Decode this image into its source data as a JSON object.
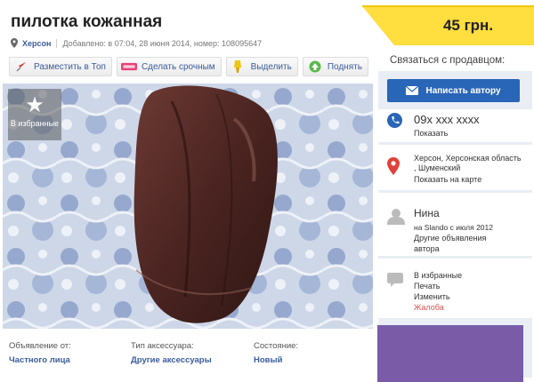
{
  "ad": {
    "title": "пилотка кожанная",
    "city": "Херсон",
    "added": "Добавлено: в 07:04, 28 июня 2014, номер: 108095647"
  },
  "actions": [
    {
      "label": "Разместить в Топ",
      "icon": "rocket-icon"
    },
    {
      "label": "Сделать срочным",
      "icon": "urgent-icon"
    },
    {
      "label": "Выделить",
      "icon": "highlighter-icon"
    },
    {
      "label": "Поднять",
      "icon": "raise-icon"
    }
  ],
  "favorite_badge": "В избранные",
  "attributes": [
    {
      "label": "Объявление от:",
      "value": "Частного лица"
    },
    {
      "label": "Тип аксессуара:",
      "value": "Другие аксессуары"
    },
    {
      "label": "Состояние:",
      "value": "Новый"
    }
  ],
  "price": "45 грн.",
  "contact": {
    "heading": "Связаться с продавцом:",
    "write_button": "Написать автору",
    "phone": "09x xxx xxxx",
    "show_phone": "Показать",
    "address": "Херсон, Херсонская область , Шуменский",
    "show_on_map": "Показать на карте",
    "seller_name": "Нина",
    "since": "на Slando с июля 2012",
    "other_ads_1": "Другие объявления",
    "other_ads_2": "автора",
    "links": [
      "В избранные",
      "Печать",
      "Изменить",
      "Жалоба"
    ]
  },
  "colors": {
    "accent_blue": "#2a66b7",
    "link_blue": "#3a5c9b",
    "price_yellow": "#ffde3f",
    "report_red": "#d9534f",
    "ad_purple": "#7a5ba8"
  }
}
